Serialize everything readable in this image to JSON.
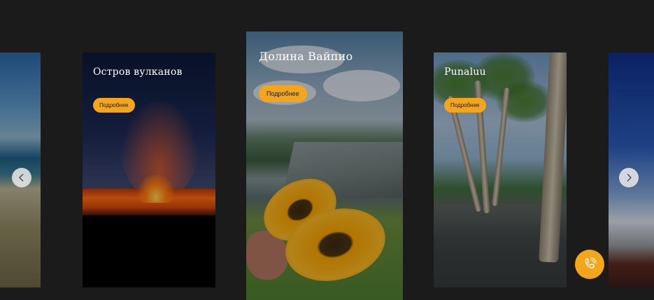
{
  "slider": {
    "cards": [
      {
        "title": "",
        "button": ""
      },
      {
        "title": "Остров вулканов",
        "button": "Подробнее"
      },
      {
        "title": "Долина Вайпио",
        "button": "Подробнее"
      },
      {
        "title": "Punaluu",
        "button": "Подробнее"
      },
      {
        "title": "",
        "button": ""
      }
    ],
    "prev_icon": "chevron-left-icon",
    "next_icon": "chevron-right-icon"
  },
  "call_button": {
    "icon": "phone-ringing-icon"
  },
  "colors": {
    "accent": "#f3a51c",
    "background": "#1b1b1b"
  }
}
